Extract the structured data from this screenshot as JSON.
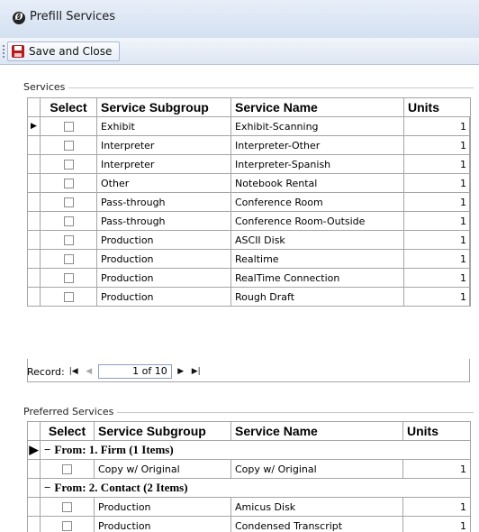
{
  "window": {
    "title": "Prefill Services"
  },
  "toolbar": {
    "save_label": "Save and Close"
  },
  "services": {
    "label": "Services",
    "columns": [
      "Select",
      "Service Subgroup",
      "Service Name",
      "Units"
    ],
    "rows": [
      {
        "subgroup": "Exhibit",
        "name": "Exhibit-Scanning",
        "units": "1"
      },
      {
        "subgroup": "Interpreter",
        "name": "Interpreter-Other",
        "units": "1"
      },
      {
        "subgroup": "Interpreter",
        "name": "Interpreter-Spanish",
        "units": "1"
      },
      {
        "subgroup": "Other",
        "name": "Notebook Rental",
        "units": "1"
      },
      {
        "subgroup": "Pass-through",
        "name": "Conference Room",
        "units": "1"
      },
      {
        "subgroup": "Pass-through",
        "name": "Conference Room-Outside",
        "units": "1"
      },
      {
        "subgroup": "Production",
        "name": "ASCII Disk",
        "units": "1"
      },
      {
        "subgroup": "Production",
        "name": "Realtime",
        "units": "1"
      },
      {
        "subgroup": "Production",
        "name": "RealTime Connection",
        "units": "1"
      },
      {
        "subgroup": "Production",
        "name": "Rough Draft",
        "units": "1"
      }
    ],
    "record_nav": {
      "label": "Record:",
      "current": "1",
      "of_text": "of 10"
    }
  },
  "preferred": {
    "label": "Preferred Services",
    "columns": [
      "Select",
      "Service Subgroup",
      "Service Name",
      "Units"
    ],
    "groups": [
      {
        "header": "From: 1. Firm (1 Items)",
        "rows": [
          {
            "subgroup": "Copy w/ Original",
            "name": "Copy w/ Original",
            "units": "1"
          }
        ]
      },
      {
        "header": "From: 2. Contact (2 Items)",
        "rows": [
          {
            "subgroup": "Production",
            "name": "Amicus Disk",
            "units": "1"
          },
          {
            "subgroup": "Production",
            "name": "Condensed Transcript",
            "units": "1"
          }
        ]
      }
    ]
  }
}
